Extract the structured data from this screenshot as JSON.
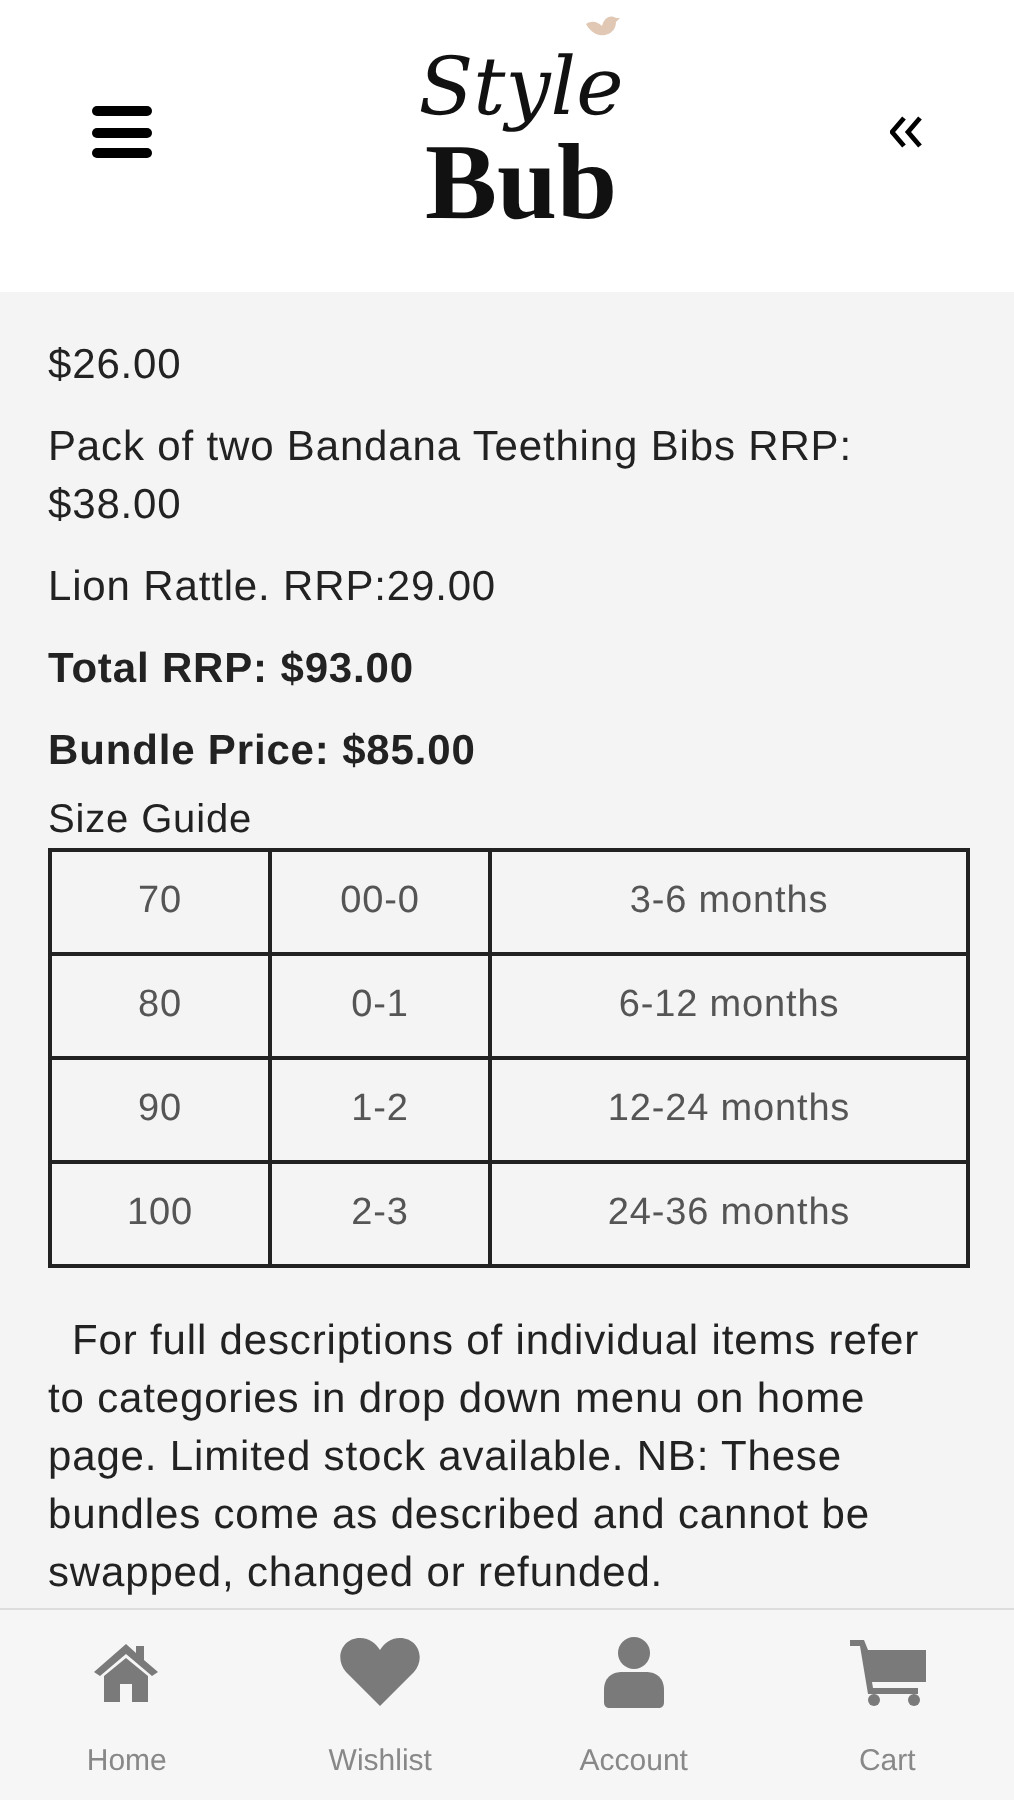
{
  "header": {
    "logo_top": "Style",
    "logo_bottom": "Bub"
  },
  "items": [
    {
      "kind": "plain",
      "text": "$26.00"
    },
    {
      "kind": "plain",
      "text": "Pack of two Bandana Teething Bibs RRP: $38.00"
    },
    {
      "kind": "plain",
      "text": "Lion Rattle. RRP:29.00"
    },
    {
      "kind": "bold",
      "text": "Total RRP: $93.00"
    },
    {
      "kind": "bold",
      "text": "Bundle Price: $85.00"
    }
  ],
  "size_guide": {
    "title": "Size Guide",
    "rows": [
      [
        "70",
        "00-0",
        "3-6 months"
      ],
      [
        "80",
        "0-1",
        "6-12 months"
      ],
      [
        "90",
        "1-2",
        "12-24 months"
      ],
      [
        "100",
        "2-3",
        "24-36 months"
      ]
    ]
  },
  "note": "For full descriptions of individual items refer to categories in drop down menu on home page. Limited stock available. NB: These bundles come as described and cannot be swapped, changed or refunded.",
  "nav": [
    {
      "kind": "home",
      "label": "Home"
    },
    {
      "kind": "wishlist",
      "label": "Wishlist"
    },
    {
      "kind": "account",
      "label": "Account"
    },
    {
      "kind": "cart",
      "label": "Cart"
    }
  ]
}
